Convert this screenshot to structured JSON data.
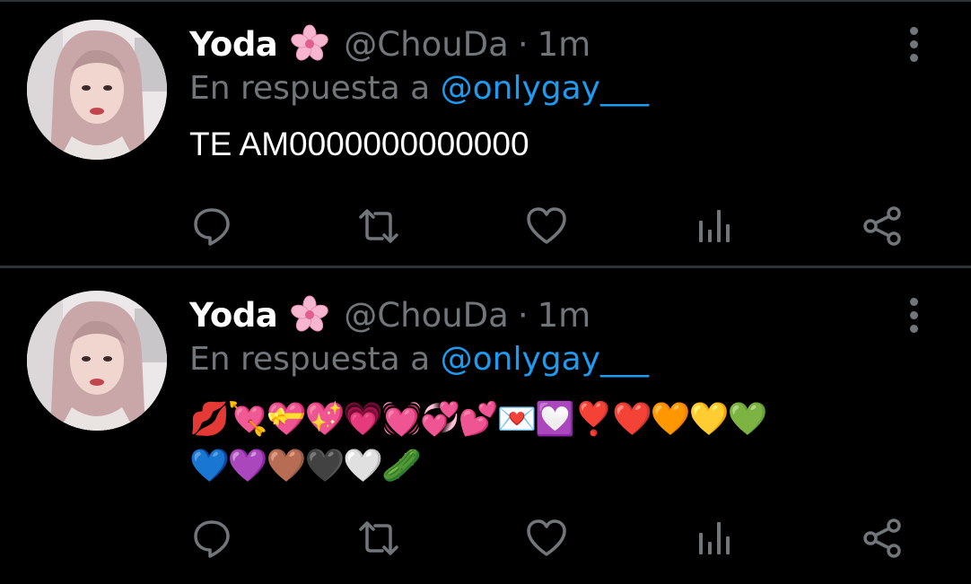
{
  "tweets": [
    {
      "name": "Yoda",
      "name_emoji": "🌸",
      "handle": "@ChouDa",
      "separator": "·",
      "time": "1m",
      "reply_prefix": "En respuesta a",
      "reply_mention": "@onlygay___",
      "text": "TE AM0000000000000",
      "emoji_lines": []
    },
    {
      "name": "Yoda",
      "name_emoji": "🌸",
      "handle": "@ChouDa",
      "separator": "·",
      "time": "1m",
      "reply_prefix": "En respuesta a",
      "reply_mention": "@onlygay___",
      "text": "",
      "emoji_lines": [
        "💋💘💝💖💗💓💞💕💌💟❣️❤️🧡💛💚",
        "💙💜🤎🖤🤍🥒"
      ]
    }
  ],
  "icons": {
    "reply": "reply-icon",
    "retweet": "retweet-icon",
    "like": "heart-icon",
    "analytics": "analytics-icon",
    "share": "share-icon",
    "more": "more-vertical-icon"
  },
  "colors": {
    "background": "#000000",
    "primary_text": "#ffffff",
    "secondary_text": "#71767b",
    "link": "#1d9bf0",
    "divider": "#2f3336"
  }
}
